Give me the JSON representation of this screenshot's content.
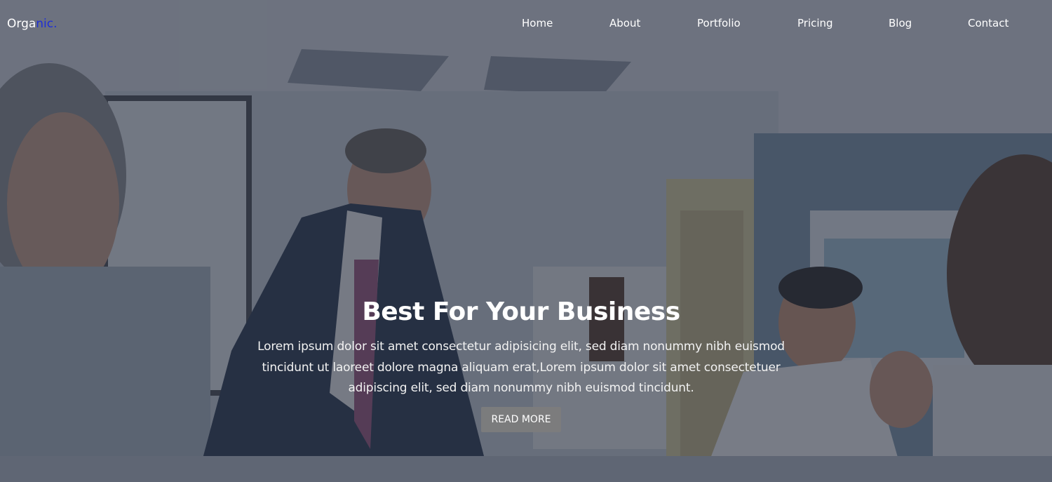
{
  "brand": {
    "logo_main": "Orga",
    "logo_accent": "nic.",
    "accent_color": "#1e2fd6"
  },
  "nav": {
    "items": [
      {
        "label": "Home"
      },
      {
        "label": "About"
      },
      {
        "label": "Portfolio"
      },
      {
        "label": "Pricing"
      },
      {
        "label": "Blog"
      },
      {
        "label": "Contact"
      }
    ]
  },
  "hero": {
    "title": "Best For Your Business",
    "description": "Lorem ipsum dolor sit amet consectetur adipisicing elit, sed diam nonummy nibh euismod tincidunt ut laoreet dolore magna aliquam erat,Lorem ipsum dolor sit amet consectetuer adipiscing elit, sed diam nonummy nibh euismod tincidunt.",
    "cta_label": "READ MORE"
  }
}
